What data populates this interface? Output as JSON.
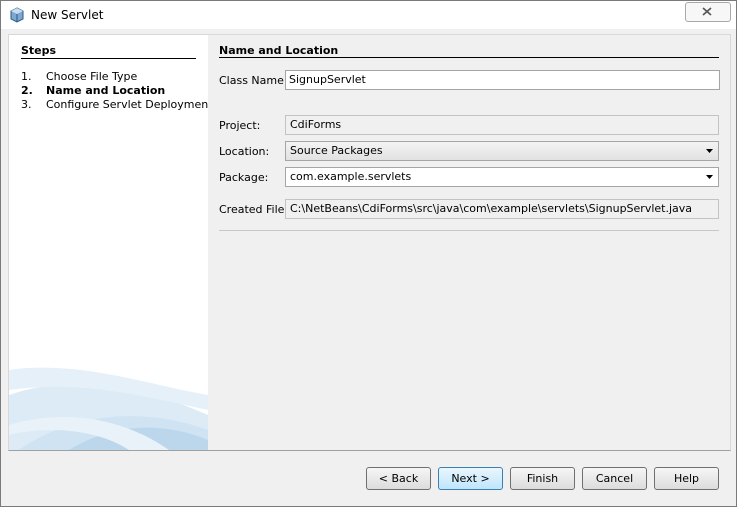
{
  "window": {
    "title": "New Servlet"
  },
  "steps": {
    "heading": "Steps",
    "items": [
      {
        "num": "1.",
        "label": "Choose File Type"
      },
      {
        "num": "2.",
        "label": "Name and Location"
      },
      {
        "num": "3.",
        "label": "Configure Servlet Deployment"
      }
    ],
    "active_index": 1
  },
  "form": {
    "heading": "Name and Location",
    "class_name": {
      "label": "Class Name:",
      "value": "SignupServlet"
    },
    "project": {
      "label": "Project:",
      "value": "CdiForms"
    },
    "location": {
      "label": "Location:",
      "value": "Source Packages"
    },
    "package": {
      "label": "Package:",
      "value": "com.example.servlets"
    },
    "created_file": {
      "label": "Created File:",
      "value": "C:\\NetBeans\\CdiForms\\src\\java\\com\\example\\servlets\\SignupServlet.java"
    }
  },
  "buttons": {
    "back": "< Back",
    "next": "Next >",
    "finish": "Finish",
    "cancel": "Cancel",
    "help": "Help"
  },
  "icons": {
    "app": "netbeans-cube-icon",
    "close": "close-icon",
    "dropdown": "chevron-down-icon"
  },
  "colors": {
    "default_button": "#bee6fd",
    "art": "#cfe3f2"
  }
}
